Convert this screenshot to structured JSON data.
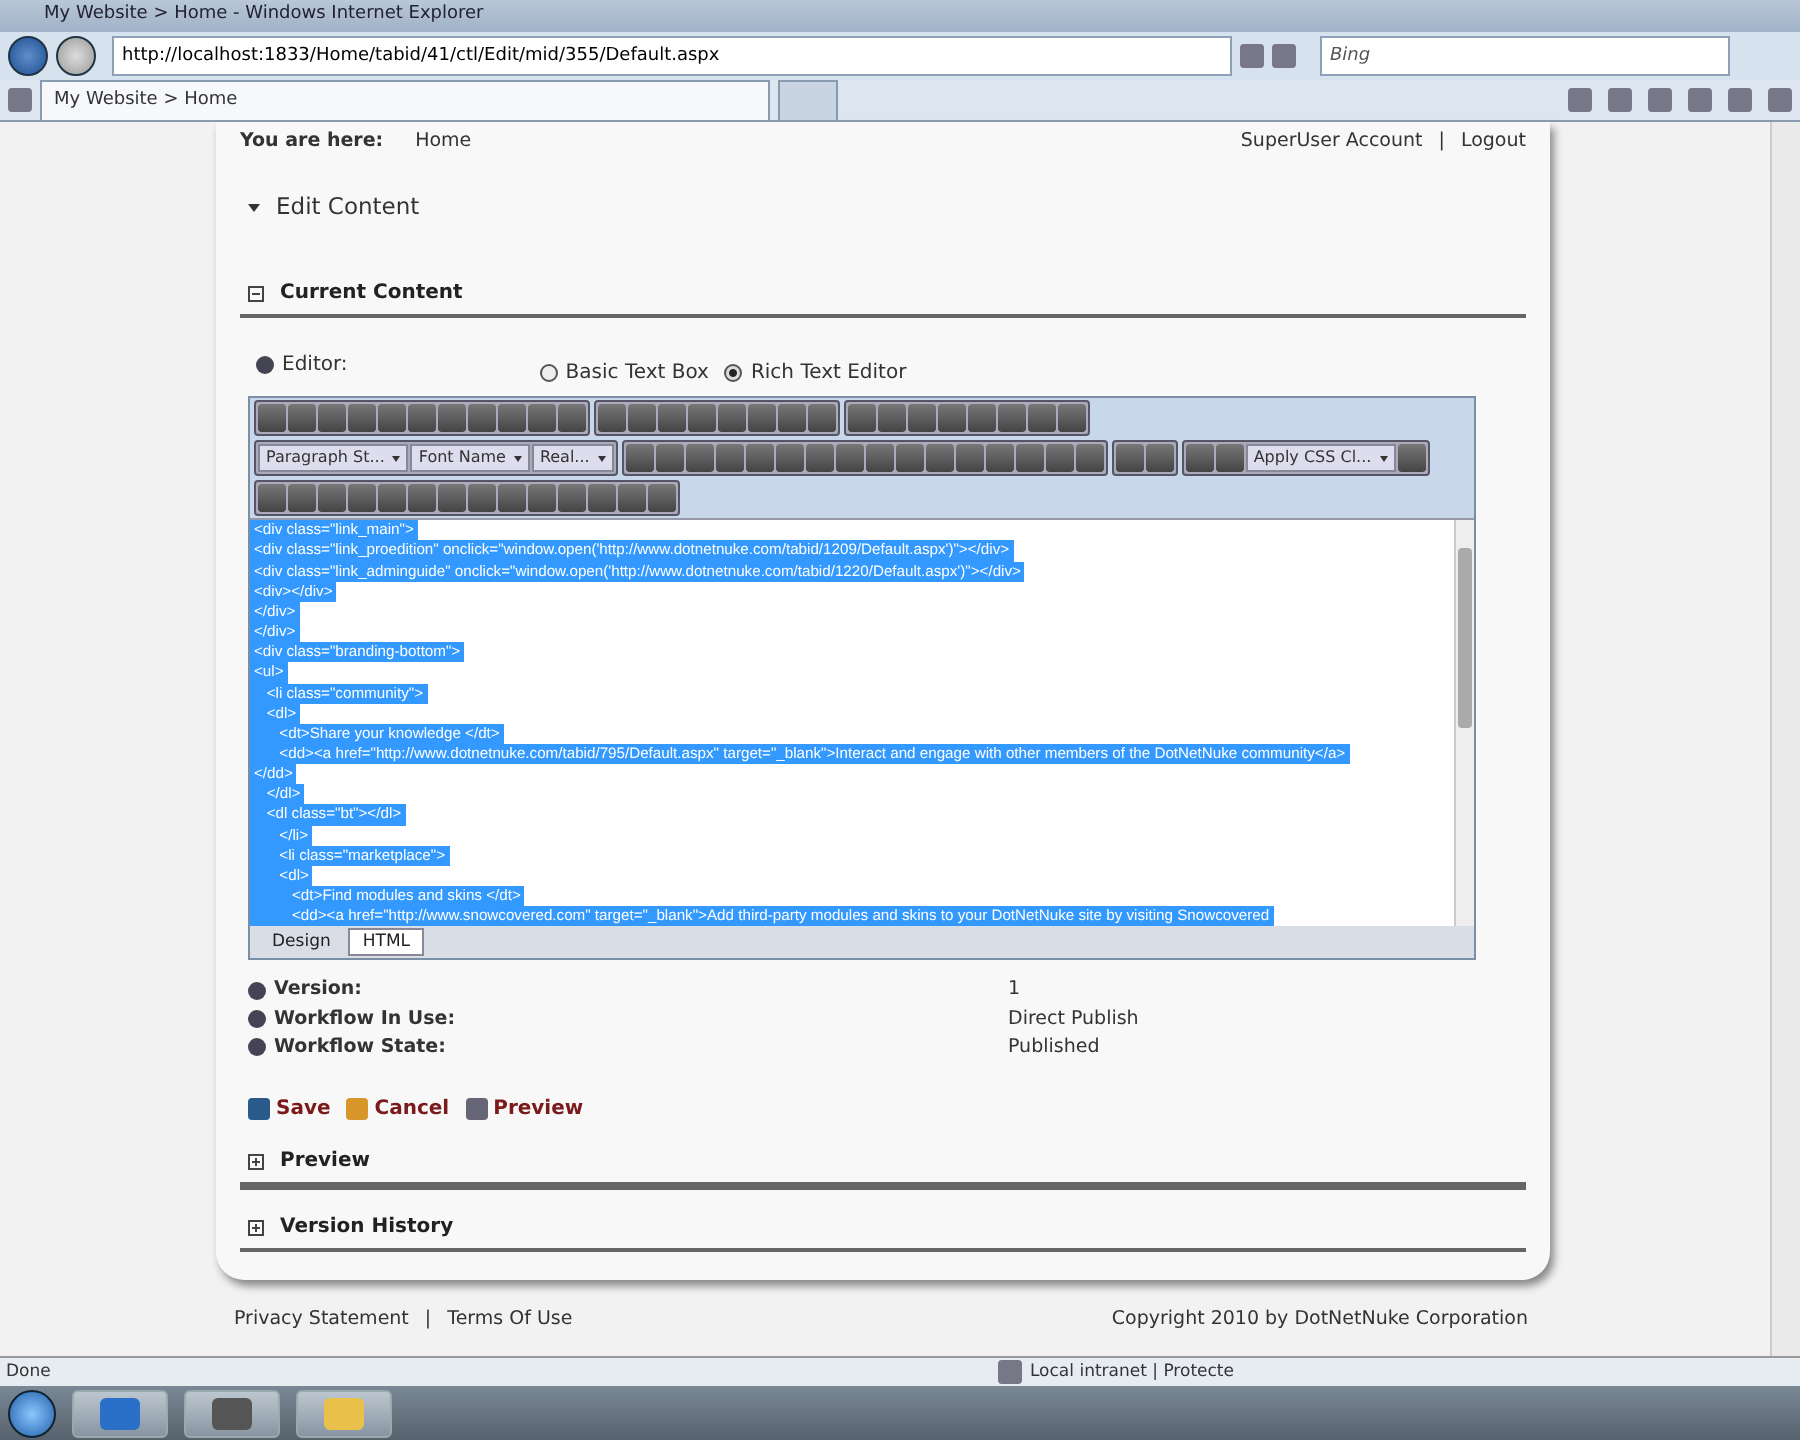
{
  "browser": {
    "title": "My Website > Home - Windows Internet Explorer",
    "address": "http://localhost:1833/Home/tabid/41/ctl/Edit/mid/355/Default.aspx",
    "search_placeholder": "Bing",
    "tabs": [
      {
        "label": "My Website > Home",
        "selected": true
      }
    ]
  },
  "header": {
    "breadcrumb_label": "You are here:",
    "breadcrumb": "Home",
    "user": "SuperUser Account",
    "separator": "|",
    "logout": "Logout"
  },
  "module_title": "Edit Content",
  "current_content": {
    "title": "Current Content",
    "expanded": true,
    "editor_label": "Editor:",
    "editor_modes": [
      {
        "label": "Basic Text Box",
        "selected": false
      },
      {
        "label": "Rich Text Editor",
        "selected": true
      }
    ],
    "dropdowns": [
      {
        "label": "Paragraph St..."
      },
      {
        "label": "Font Name"
      },
      {
        "label": "Real..."
      },
      {
        "label": "Apply CSS Cl..."
      }
    ],
    "code_lines": [
      {
        "text": "<div class=\"link_main\">",
        "selected": true
      },
      {
        "text": "<div class=\"link_proedition\" onclick=\"window.open('http://www.dotnetnuke.com/tabid/1209/Default.aspx')\"></div>",
        "selected": true
      },
      {
        "text": "<div class=\"link_adminguide\" onclick=\"window.open('http://www.dotnetnuke.com/tabid/1220/Default.aspx')\"></div>",
        "selected": true
      },
      {
        "text": "<div></div>",
        "selected": true
      },
      {
        "text": "</div>",
        "selected": true
      },
      {
        "text": "</div>",
        "selected": true
      },
      {
        "text": "<div class=\"branding-bottom\">",
        "selected": true
      },
      {
        "text": "<ul>",
        "selected": true
      },
      {
        "text": "   <li class=\"community\">",
        "selected": true
      },
      {
        "text": "   <dl>",
        "selected": true
      },
      {
        "text": "      <dt>Share your knowledge </dt>",
        "selected": true
      },
      {
        "text": "      <dd><a href=\"http://www.dotnetnuke.com/tabid/795/Default.aspx\" target=\"_blank\">Interact and engage with other members of the DotNetNuke community</a>",
        "selected": true
      },
      {
        "text": "</dd>",
        "selected": true
      },
      {
        "text": "   </dl>",
        "selected": true
      },
      {
        "text": "   <dl class=\"bt\"></dl>",
        "selected": true
      },
      {
        "text": "      </li>",
        "selected": true
      },
      {
        "text": "      <li class=\"marketplace\">",
        "selected": true
      },
      {
        "text": "      <dl>",
        "selected": true
      },
      {
        "text": "         <dt>Find modules and skins </dt>",
        "selected": true
      },
      {
        "text": "         <dd><a href=\"http://www.snowcovered.com\" target=\"_blank\">Add third-party modules and skins to your DotNetNuke site by visiting Snowcovered",
        "selected": true
      }
    ],
    "view_tabs": [
      {
        "label": "Design",
        "selected": false
      },
      {
        "label": "HTML",
        "selected": true
      }
    ],
    "info": [
      {
        "label": "Version:",
        "value": "1"
      },
      {
        "label": "Workflow In Use:",
        "value": "Direct Publish"
      },
      {
        "label": "Workflow State:",
        "value": "Published"
      }
    ],
    "actions": [
      {
        "kind": "save",
        "label": "Save"
      },
      {
        "kind": "cancel",
        "label": "Cancel"
      },
      {
        "kind": "preview",
        "label": "Preview"
      }
    ]
  },
  "sections": [
    {
      "title": "Preview",
      "expanded": false
    },
    {
      "title": "Version History",
      "expanded": false
    }
  ],
  "footer": {
    "links": [
      "Privacy Statement",
      "Terms Of Use"
    ],
    "separator": "|",
    "copyright": "Copyright 2010 by DotNetNuke Corporation"
  },
  "status_bar": {
    "text": "Done",
    "zone": "Local intranet | Protecte"
  }
}
